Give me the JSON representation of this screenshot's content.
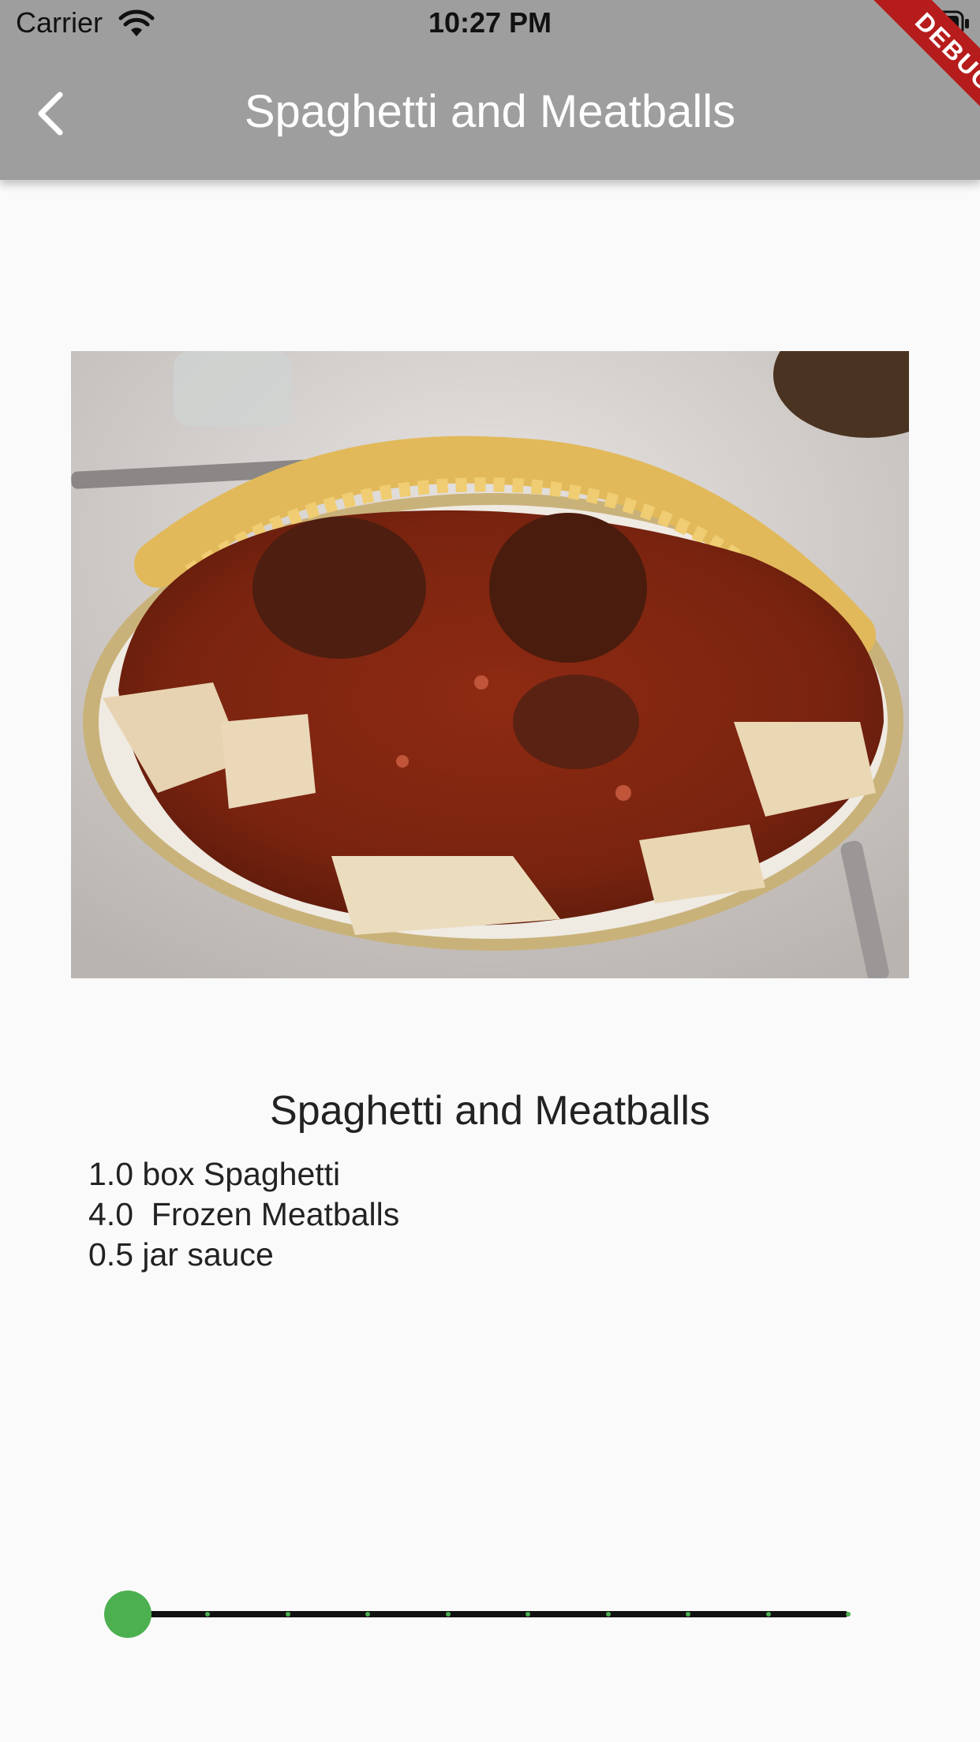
{
  "status_bar": {
    "carrier": "Carrier",
    "time": "10:27 PM"
  },
  "app_bar": {
    "title": "Spaghetti and Meatballs",
    "back_icon": "chevron-left-icon",
    "color": "#9e9e9e"
  },
  "debug_banner": {
    "label": "DEBUG",
    "color": "#b71c1c"
  },
  "recipe": {
    "image_subject": "plate of spaghetti and meatballs",
    "title": "Spaghetti and Meatballs",
    "ingredients": [
      "1.0 box Spaghetti",
      "4.0  Frozen Meatballs",
      "0.5 jar sauce"
    ]
  },
  "servings_slider": {
    "value_fraction": 0,
    "divisions": 9,
    "accent_color": "#4caf50"
  }
}
